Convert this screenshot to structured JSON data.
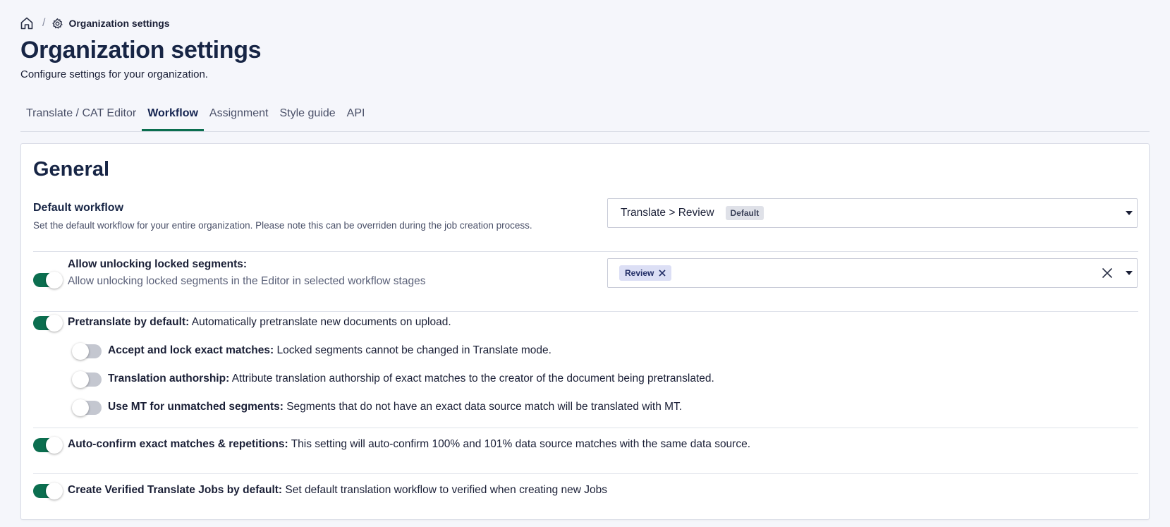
{
  "breadcrumb": {
    "separator": "/",
    "current": "Organization settings"
  },
  "header": {
    "title": "Organization settings",
    "subtitle": "Configure settings for your organization."
  },
  "tabs": [
    {
      "label": "Translate / CAT Editor",
      "active": false
    },
    {
      "label": "Workflow",
      "active": true
    },
    {
      "label": "Assignment",
      "active": false
    },
    {
      "label": "Style guide",
      "active": false
    },
    {
      "label": "API",
      "active": false
    }
  ],
  "general": {
    "title": "General",
    "default_workflow": {
      "label": "Default workflow",
      "description": "Set the default workflow for your entire organization. Please note this can be overriden during the job creation process.",
      "value": "Translate > Review",
      "badge": "Default"
    },
    "unlock_segments": {
      "label": "Allow unlocking locked segments:",
      "description": "Allow unlocking locked segments in the Editor in selected workflow stages",
      "enabled": true,
      "selected_stage": "Review"
    },
    "pretranslate": {
      "label": "Pretranslate by default:",
      "description": "Automatically pretranslate new documents on upload.",
      "enabled": true
    },
    "accept_lock": {
      "label": "Accept and lock exact matches:",
      "description": "Locked segments cannot be changed in Translate mode.",
      "enabled": false
    },
    "authorship": {
      "label": "Translation authorship:",
      "description": "Attribute translation authorship of exact matches to the creator of the document being pretranslated.",
      "enabled": false
    },
    "use_mt": {
      "label": "Use MT for unmatched segments:",
      "description": "Segments that do not have an exact data source match will be translated with MT.",
      "enabled": false
    },
    "auto_confirm": {
      "label": "Auto-confirm exact matches & repetitions:",
      "description": "This setting will auto-confirm 100% and 101% data source matches with the same data source.",
      "enabled": true
    },
    "verified_jobs": {
      "label": "Create Verified Translate Jobs by default:",
      "description": "Set default translation workflow to verified when creating new Jobs",
      "enabled": true
    }
  },
  "colors": {
    "accent": "#0b6e4f",
    "title": "#172545",
    "toggle_off": "#c4c7d0",
    "chip_bg": "#dcdff5"
  },
  "icons": {
    "home": "home-icon",
    "settings": "gear-icon",
    "chip_remove": "close-icon",
    "clear": "close-icon",
    "dropdown": "caret-down-icon"
  }
}
